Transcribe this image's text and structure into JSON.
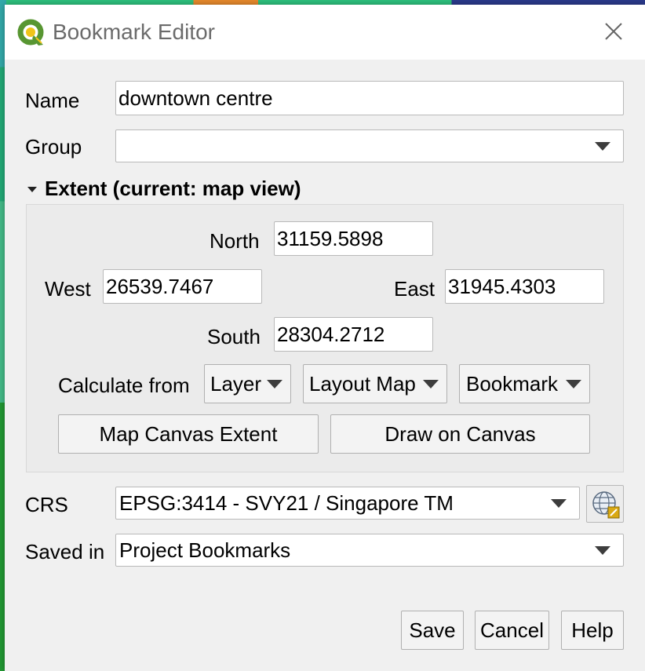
{
  "window": {
    "title": "Bookmark Editor"
  },
  "form": {
    "name_label": "Name",
    "name_value": "downtown centre",
    "group_label": "Group",
    "group_value": ""
  },
  "extent": {
    "section_title": "Extent (current: map view)",
    "north_label": "North",
    "north_value": "31159.5898",
    "west_label": "West",
    "west_value": "26539.7467",
    "east_label": "East",
    "east_value": "31945.4303",
    "south_label": "South",
    "south_value": "28304.2712",
    "calculate_label": "Calculate from",
    "calc_layer": "Layer",
    "calc_layout_map": "Layout Map",
    "calc_bookmark": "Bookmark",
    "map_canvas_extent": "Map Canvas Extent",
    "draw_on_canvas": "Draw on Canvas"
  },
  "crs": {
    "label": "CRS",
    "value": "EPSG:3414 - SVY21 / Singapore TM"
  },
  "saved_in": {
    "label": "Saved in",
    "value": "Project Bookmarks"
  },
  "buttons": {
    "save": "Save",
    "cancel": "Cancel",
    "help": "Help"
  },
  "colors": {
    "qgis_green": "#589632",
    "qgis_yellow": "#f0c419",
    "background_map": "#2ec27e"
  },
  "icons": {
    "app": "qgis-logo-icon",
    "close": "close-icon",
    "crs_select": "globe-crs-icon"
  }
}
